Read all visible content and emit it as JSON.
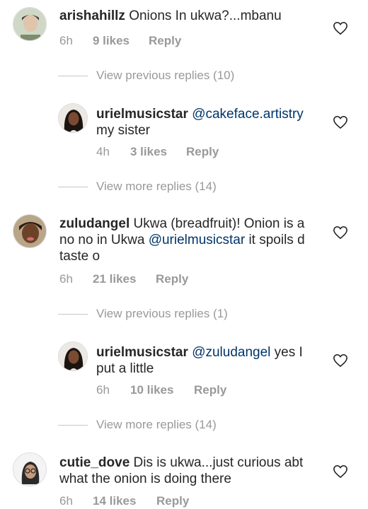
{
  "comments": [
    {
      "username": "arishahillz",
      "text_parts": [
        "Onions In ukwa?...mbanu"
      ],
      "time": "6h",
      "likes": "9 likes",
      "reply": "Reply"
    },
    {
      "username": "urielmusicstar",
      "mention": "@cakeface.artistry",
      "text_parts": [
        "my sister"
      ],
      "time": "4h",
      "likes": "3 likes",
      "reply": "Reply"
    },
    {
      "username": "zuludangel",
      "text_parts": [
        "Ukwa (breadfruit)! Onion is a no no in Ukwa ",
        " it spoils d taste o"
      ],
      "mention": "@urielmusicstar",
      "time": "6h",
      "likes": "21 likes",
      "reply": "Reply"
    },
    {
      "username": "urielmusicstar",
      "mention": "@zuludangel",
      "text_parts": [
        " yes I put a little"
      ],
      "time": "6h",
      "likes": "10 likes",
      "reply": "Reply"
    },
    {
      "username": "cutie_dove",
      "text_parts": [
        "Dis is ukwa...just curious abt what the onion is doing there"
      ],
      "time": "6h",
      "likes": "14 likes",
      "reply": "Reply"
    }
  ],
  "view_links": [
    "View previous replies (10)",
    "View more replies (14)",
    "View previous replies (1)",
    "View more replies (14)"
  ],
  "colors": {
    "text": "#262626",
    "meta": "#999999",
    "mention": "#003569",
    "divider": "#c7c7c7"
  },
  "icons": {
    "like": "heart-outline-icon"
  }
}
